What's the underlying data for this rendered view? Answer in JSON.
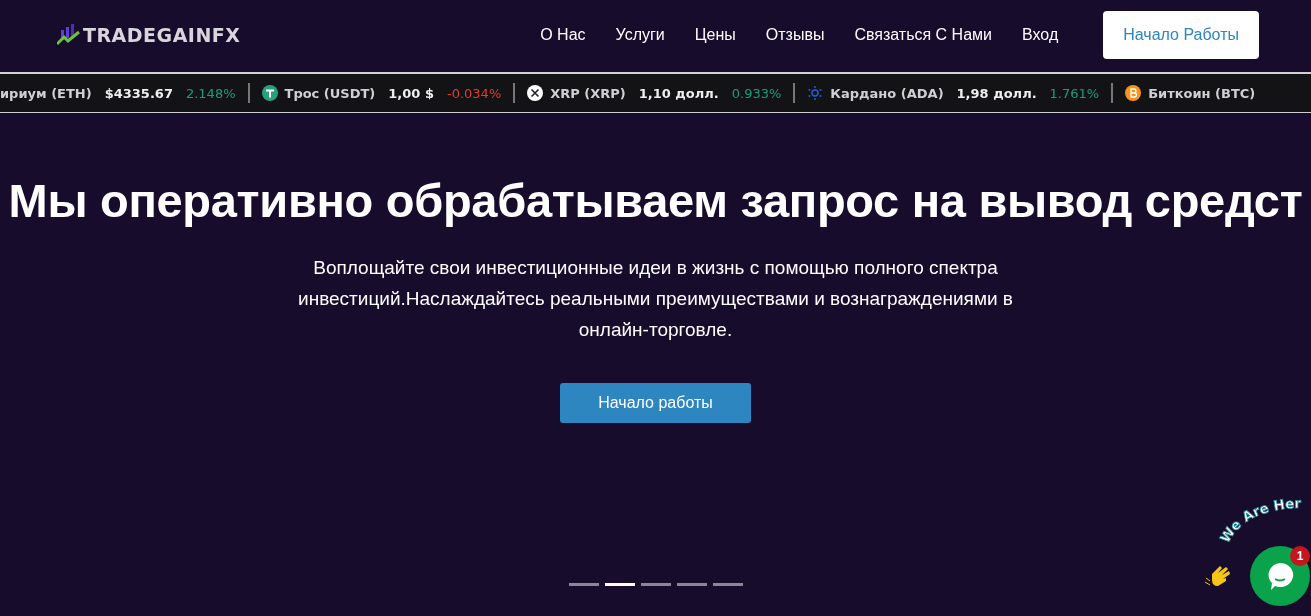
{
  "header": {
    "logo": "TRADEGAINFX",
    "nav": [
      {
        "label": "О Нас"
      },
      {
        "label": "Услуги"
      },
      {
        "label": "Цены"
      },
      {
        "label": "Отзывы"
      },
      {
        "label": "Связаться С Нами"
      },
      {
        "label": "Вход"
      }
    ],
    "cta": "Начало Работы"
  },
  "ticker": [
    {
      "kind": "plain",
      "name": "ириум (ETH)",
      "price": "$4335.67",
      "change": "2.148%",
      "color": "#1a9c7f"
    },
    {
      "kind": "tether",
      "name": "Трос (USDT)",
      "price": "1,00 $",
      "change": "-0.034%",
      "color": "#e03a3a"
    },
    {
      "kind": "xrp",
      "name": "XRP (XRP)",
      "price": "1,10 долл.",
      "change": "0.933%",
      "color": "#1a9c7f"
    },
    {
      "kind": "cardano",
      "name": "Кардано (ADA)",
      "price": "1,98 долл.",
      "change": "1.761%",
      "color": "#1a9c7f"
    },
    {
      "kind": "bitcoin",
      "name": "Биткоин (BTC)"
    }
  ],
  "hero": {
    "headline": "Мы оперативно обрабатываем запрос на вывод средст",
    "text": "Воплощайте свои инвестиционные идеи в жизнь с помощью полного спектра инвестиций.Наслаждайтесь реальными преимуществами и вознаграждениями в онлайн-торговле.",
    "button": "Начало работы"
  },
  "slides": [
    {
      "selected": false
    },
    {
      "selected": true
    },
    {
      "selected": false
    },
    {
      "selected": false
    },
    {
      "selected": false
    }
  ],
  "chat": {
    "caption": "We Are Her",
    "badge": "1"
  }
}
